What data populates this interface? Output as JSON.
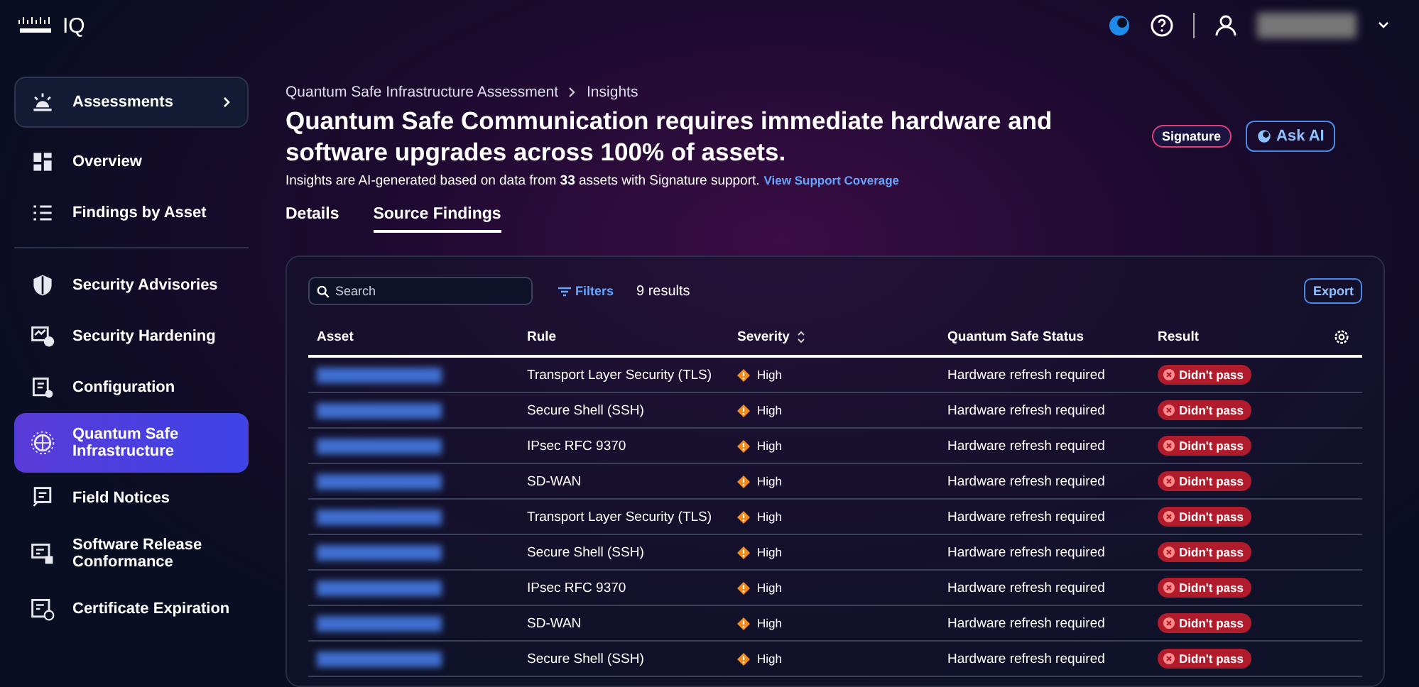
{
  "header": {
    "brand": "IQ"
  },
  "sidebar": {
    "items": [
      {
        "label": "Assessments",
        "kind": "group",
        "selected": false
      },
      {
        "label": "Overview",
        "kind": "item",
        "selected": false
      },
      {
        "label": "Findings by Asset",
        "kind": "item",
        "selected": false
      },
      {
        "label": "Security Advisories",
        "kind": "item",
        "selected": false
      },
      {
        "label": "Security Hardening",
        "kind": "item",
        "selected": false
      },
      {
        "label": "Configuration",
        "kind": "item",
        "selected": false
      },
      {
        "label": "Quantum Safe Infrastructure",
        "kind": "item",
        "selected": true
      },
      {
        "label": "Field Notices",
        "kind": "item",
        "selected": false
      },
      {
        "label": "Software Release Conformance",
        "kind": "item",
        "selected": false
      },
      {
        "label": "Certificate Expiration",
        "kind": "item",
        "selected": false
      }
    ]
  },
  "breadcrumb": [
    "Quantum Safe Infrastructure Assessment",
    "Insights"
  ],
  "title": "Quantum Safe Communication requires immediate hardware and software upgrades across 100% of assets.",
  "subtitle": "Insights are AI-generated based on data from **33** assets with Signature support.",
  "support_link": "View Support Coverage",
  "badge": "Signature",
  "ask_button": "Ask AI",
  "tabs": [
    {
      "label": "Details",
      "selected": false
    },
    {
      "label": "Source Findings",
      "selected": true
    }
  ],
  "toolbar": {
    "search_placeholder": "Search",
    "filters": "Filters",
    "results": "9 results",
    "export": "Export"
  },
  "table": {
    "columns": [
      "Asset",
      "Rule",
      "Severity",
      "Quantum Safe Status",
      "Result"
    ],
    "rows": [
      {
        "rule": "Transport Layer Security (TLS)",
        "severity": "High",
        "status": "Hardware refresh required",
        "result": "Didn't pass"
      },
      {
        "rule": "Secure Shell (SSH)",
        "severity": "High",
        "status": "Hardware refresh required",
        "result": "Didn't pass"
      },
      {
        "rule": "IPsec RFC 9370",
        "severity": "High",
        "status": "Hardware refresh required",
        "result": "Didn't pass"
      },
      {
        "rule": "SD-WAN",
        "severity": "High",
        "status": "Hardware refresh required",
        "result": "Didn't pass"
      },
      {
        "rule": "Transport Layer Security (TLS)",
        "severity": "High",
        "status": "Hardware refresh required",
        "result": "Didn't pass"
      },
      {
        "rule": "Secure Shell (SSH)",
        "severity": "High",
        "status": "Hardware refresh required",
        "result": "Didn't pass"
      },
      {
        "rule": "IPsec RFC 9370",
        "severity": "High",
        "status": "Hardware refresh required",
        "result": "Didn't pass"
      },
      {
        "rule": "SD-WAN",
        "severity": "High",
        "status": "Hardware refresh required",
        "result": "Didn't pass"
      },
      {
        "rule": "Secure Shell (SSH)",
        "severity": "High",
        "status": "Hardware refresh required",
        "result": "Didn't pass"
      }
    ]
  }
}
